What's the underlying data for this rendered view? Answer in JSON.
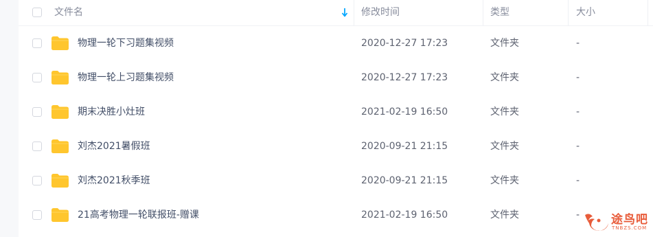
{
  "header": {
    "name_label": "文件名",
    "time_label": "修改时间",
    "type_label": "类型",
    "size_label": "大小",
    "sort_icon": "arrow-down-icon"
  },
  "files": [
    {
      "name": "物理一轮下习题集视频",
      "modified": "2020-12-27 17:23",
      "type": "文件夹",
      "size": "-"
    },
    {
      "name": "物理一轮上习题集视频",
      "modified": "2020-12-27 17:23",
      "type": "文件夹",
      "size": "-"
    },
    {
      "name": "期末决胜小灶班",
      "modified": "2021-02-19 16:50",
      "type": "文件夹",
      "size": "-"
    },
    {
      "name": "刘杰2021暑假班",
      "modified": "2020-09-21 21:15",
      "type": "文件夹",
      "size": "-"
    },
    {
      "name": "刘杰2021秋季班",
      "modified": "2020-09-21 21:15",
      "type": "文件夹",
      "size": "-"
    },
    {
      "name": "21高考物理一轮联报班-赠课",
      "modified": "2021-02-19 16:50",
      "type": "文件夹",
      "size": "-"
    }
  ],
  "watermark": {
    "text": "途鸟吧",
    "sub": "TNBZS.COM"
  },
  "colors": {
    "folder": "#ffc62e",
    "accent": "#06a7ff",
    "watermark": "#e85c3a"
  }
}
